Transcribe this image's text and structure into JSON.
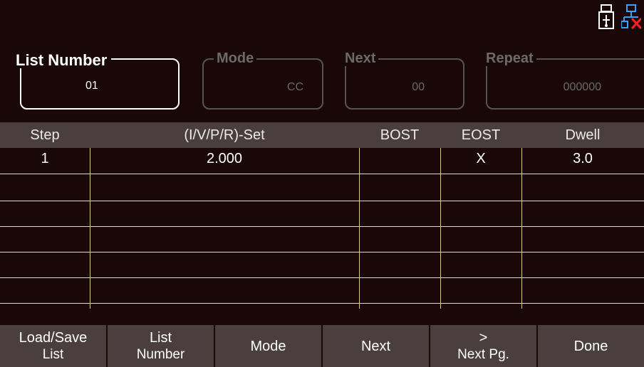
{
  "status": {
    "icons": [
      "usb-icon",
      "network-disconnected-icon"
    ]
  },
  "params": {
    "list_number": {
      "label": "List Number",
      "value": "01"
    },
    "mode": {
      "label": "Mode",
      "value": "CC"
    },
    "next": {
      "label": "Next",
      "value": "00"
    },
    "repeat": {
      "label": "Repeat",
      "value": "000000"
    }
  },
  "table": {
    "headers": [
      "Step",
      "(I/V/P/R)-Set",
      "BOST",
      "EOST",
      "Dwell"
    ],
    "rows": [
      {
        "step": "1",
        "set": "2.000",
        "bost": "",
        "eost": "X",
        "dwell": "3.0"
      },
      {
        "step": "",
        "set": "",
        "bost": "",
        "eost": "",
        "dwell": ""
      },
      {
        "step": "",
        "set": "",
        "bost": "",
        "eost": "",
        "dwell": ""
      },
      {
        "step": "",
        "set": "",
        "bost": "",
        "eost": "",
        "dwell": ""
      },
      {
        "step": "",
        "set": "",
        "bost": "",
        "eost": "",
        "dwell": ""
      },
      {
        "step": "",
        "set": "",
        "bost": "",
        "eost": "",
        "dwell": ""
      }
    ]
  },
  "softkeys": [
    {
      "line1": "Load/Save",
      "line2": "List"
    },
    {
      "line1": "List",
      "line2": "Number"
    },
    {
      "line1": "Mode",
      "line2": ""
    },
    {
      "line1": "Next",
      "line2": ""
    },
    {
      "line1": ">",
      "line2": "Next Pg."
    },
    {
      "line1": "Done",
      "line2": ""
    }
  ],
  "colors": {
    "background": "#1a0808",
    "header_bar": "#4a3e3e",
    "divider": "#d8c78a",
    "inactive_text": "#6a6a6a"
  }
}
